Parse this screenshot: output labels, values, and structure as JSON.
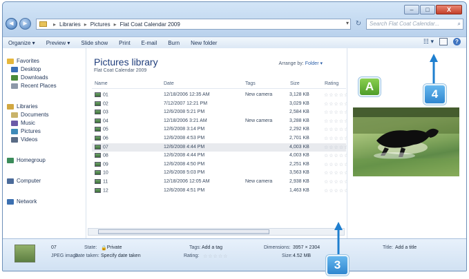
{
  "window": {
    "caption_buttons": [
      "–",
      "□",
      "X"
    ],
    "nav": {
      "back_icon": "back-arrow-icon",
      "forward_icon": "forward-arrow-icon",
      "back": "◄",
      "forward": "►"
    },
    "address": {
      "parts": [
        "Libraries",
        "Pictures",
        "Flat Coat Calendar 2009"
      ],
      "dropdown": "▾"
    },
    "search": {
      "placeholder": "Search Flat Coat Calendar...",
      "icon": "search-icon",
      "glyph": "⌕"
    },
    "refresh_glyph": "↻"
  },
  "toolbar": {
    "items": [
      "Organize ▾",
      "Preview ▾",
      "Slide show",
      "Print",
      "E-mail",
      "Burn",
      "New folder"
    ],
    "views_glyph": "☷ ▾",
    "help_glyph": "?"
  },
  "sidebar": {
    "items": [
      {
        "label": "Favorites",
        "icon": "star-icon",
        "color": "#e6b73c",
        "indent": false
      },
      {
        "label": "Desktop",
        "icon": "desktop-icon",
        "color": "#3a6fb6",
        "indent": true
      },
      {
        "label": "Downloads",
        "icon": "downloads-icon",
        "color": "#4a8a3a",
        "indent": true
      },
      {
        "label": "Recent Places",
        "icon": "recent-places-icon",
        "color": "#8d98a8",
        "indent": true
      },
      {
        "label": "Libraries",
        "icon": "libraries-icon",
        "color": "#d1a741",
        "indent": false
      },
      {
        "label": "Documents",
        "icon": "documents-icon",
        "color": "#c9b36a",
        "indent": true
      },
      {
        "label": "Music",
        "icon": "music-icon",
        "color": "#6b5aa8",
        "indent": true
      },
      {
        "label": "Pictures",
        "icon": "pictures-icon",
        "color": "#3f8ab8",
        "indent": true
      },
      {
        "label": "Videos",
        "icon": "videos-icon",
        "color": "#5a6c86",
        "indent": true
      },
      {
        "label": "Homegroup",
        "icon": "homegroup-icon",
        "color": "#3b8c5a",
        "indent": false
      },
      {
        "label": "Computer",
        "icon": "computer-icon",
        "color": "#4b6b9a",
        "indent": false
      },
      {
        "label": "Network",
        "icon": "network-icon",
        "color": "#3b6fb0",
        "indent": false
      }
    ]
  },
  "library": {
    "title": "Pictures library",
    "subtitle": "Flat Coat Calendar 2009",
    "arrange_label": "Arrange by:",
    "arrange_value": "Folder ▾"
  },
  "columns": [
    "Name",
    "Date",
    "Tags",
    "Size",
    "Rating"
  ],
  "files": [
    {
      "name": "01",
      "date": "12/18/2006 12:35 AM",
      "tags": "New camera",
      "size": "3,128 KB"
    },
    {
      "name": "02",
      "date": "7/12/2007 12:21 PM",
      "tags": "",
      "size": "3,029 KB"
    },
    {
      "name": "03",
      "date": "12/6/2008 5:21 PM",
      "tags": "",
      "size": "2,584 KB"
    },
    {
      "name": "04",
      "date": "12/18/2006 3:21 AM",
      "tags": "New camera",
      "size": "3,288 KB"
    },
    {
      "name": "05",
      "date": "12/6/2008 3:14 PM",
      "tags": "",
      "size": "2,292 KB"
    },
    {
      "name": "06",
      "date": "12/6/2008 4:53 PM",
      "tags": "",
      "size": "2,701 KB"
    },
    {
      "name": "07",
      "date": "12/6/2008 4:44 PM",
      "tags": "",
      "size": "4,003 KB"
    },
    {
      "name": "08",
      "date": "12/6/2008 4:44 PM",
      "tags": "",
      "size": "4,003 KB"
    },
    {
      "name": "09",
      "date": "12/6/2008 4:50 PM",
      "tags": "",
      "size": "2,251 KB"
    },
    {
      "name": "10",
      "date": "12/6/2008 5:03 PM",
      "tags": "",
      "size": "3,563 KB"
    },
    {
      "name": "11",
      "date": "12/18/2006 12:05 AM",
      "tags": "New camera",
      "size": "2,938 KB"
    },
    {
      "name": "12",
      "date": "12/6/2008 4:51 PM",
      "tags": "",
      "size": "1,463 KB"
    }
  ],
  "rating_stars": "☆☆☆☆☆",
  "selected_index": 6,
  "details": {
    "name": "07",
    "type": "JPEG image",
    "state_label": "State:",
    "state_value": "Private",
    "date_taken_label": "Date taken:",
    "date_taken_value": "Specify date taken",
    "tags_label": "Tags:",
    "tags_value": "Add a tag",
    "rating_label": "Rating:",
    "dimensions_label": "Dimensions:",
    "dimensions_value": "3957 × 2304",
    "size_label": "Size:",
    "size_value": "4.52 MB",
    "title_label": "Title:",
    "title_value": "Add a title"
  },
  "callouts": {
    "a": "A",
    "three": "3",
    "four": "4"
  },
  "colors": {
    "callout_green": "#6bbf3c",
    "callout_blue": "#3a95d8",
    "arrow": "#1f7fcf"
  }
}
